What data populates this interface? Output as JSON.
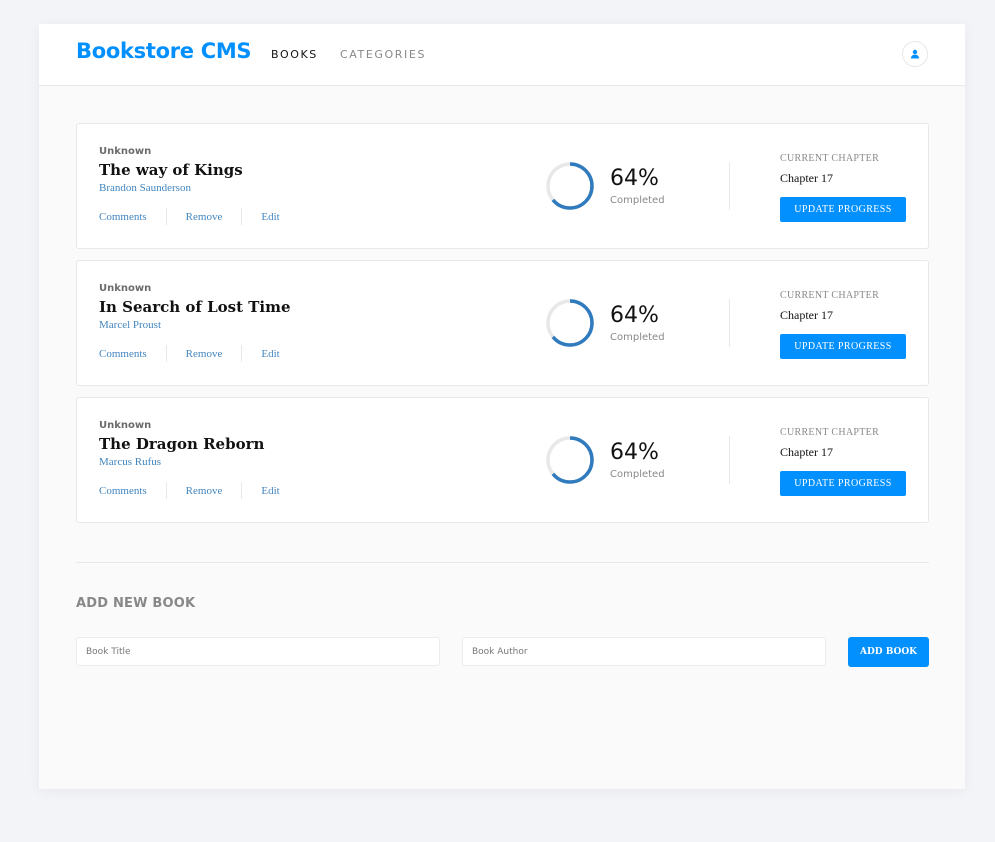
{
  "header": {
    "logo": "Bookstore CMS",
    "nav": {
      "books": "BOOKS",
      "categories": "CATEGORIES"
    },
    "user_icon": "user-icon"
  },
  "books": [
    {
      "genre": "Unknown",
      "title": "The way of Kings",
      "author": "Brandon Saunderson",
      "actions": {
        "comments": "Comments",
        "remove": "Remove",
        "edit": "Edit"
      },
      "progress_percent": 64,
      "progress_label": "64%",
      "completed_label": "Completed",
      "chapter_label": "CURRENT CHAPTER",
      "chapter": "Chapter 17",
      "update_label": "UPDATE PROGRESS"
    },
    {
      "genre": "Unknown",
      "title": "In Search of Lost Time",
      "author": "Marcel Proust",
      "actions": {
        "comments": "Comments",
        "remove": "Remove",
        "edit": "Edit"
      },
      "progress_percent": 64,
      "progress_label": "64%",
      "completed_label": "Completed",
      "chapter_label": "CURRENT CHAPTER",
      "chapter": "Chapter 17",
      "update_label": "UPDATE PROGRESS"
    },
    {
      "genre": "Unknown",
      "title": "The Dragon Reborn",
      "author": "Marcus Rufus",
      "actions": {
        "comments": "Comments",
        "remove": "Remove",
        "edit": "Edit"
      },
      "progress_percent": 64,
      "progress_label": "64%",
      "completed_label": "Completed",
      "chapter_label": "CURRENT CHAPTER",
      "chapter": "Chapter 17",
      "update_label": "UPDATE PROGRESS"
    }
  ],
  "form": {
    "title": "ADD NEW BOOK",
    "title_placeholder": "Book Title",
    "author_placeholder": "Book Author",
    "title_value": "",
    "author_value": "",
    "submit_label": "ADD BOOK"
  },
  "colors": {
    "accent": "#0290ff",
    "progress": "#307bbe",
    "progress_track": "#e8e8e8",
    "author_link": "#4386bf"
  }
}
